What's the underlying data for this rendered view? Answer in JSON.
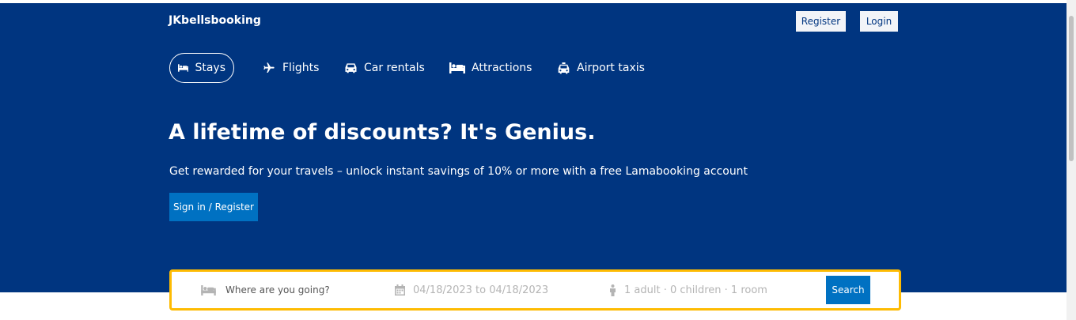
{
  "brand": {
    "logo_text": "JKbellsbooking"
  },
  "header": {
    "register_label": "Register",
    "login_label": "Login"
  },
  "nav": {
    "items": [
      {
        "label": "Stays",
        "icon": "bed-icon",
        "active": true
      },
      {
        "label": "Flights",
        "icon": "plane-icon",
        "active": false
      },
      {
        "label": "Car rentals",
        "icon": "car-icon",
        "active": false
      },
      {
        "label": "Attractions",
        "icon": "bed-icon",
        "active": false
      },
      {
        "label": "Airport taxis",
        "icon": "taxi-icon",
        "active": false
      }
    ]
  },
  "hero": {
    "title": "A lifetime of discounts? It's Genius.",
    "description": "Get rewarded for your travels – unlock instant savings of 10% or more with a free Lamabooking account",
    "cta_label": "Sign in / Register"
  },
  "search": {
    "destination_placeholder": "Where are you going?",
    "date_range": "04/18/2023 to 04/18/2023",
    "guests_summary": "1 adult · 0 children · 1 room",
    "button_label": "Search"
  },
  "colors": {
    "brand_blue": "#003580",
    "button_blue": "#0071c2",
    "search_border": "#febb02"
  }
}
